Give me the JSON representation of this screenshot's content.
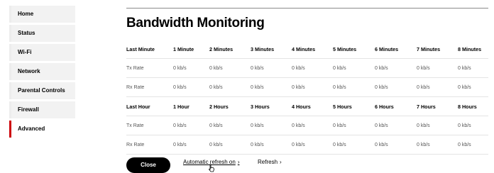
{
  "sidebar": {
    "items": [
      {
        "label": "Home"
      },
      {
        "label": "Status"
      },
      {
        "label": "Wi-Fi"
      },
      {
        "label": "Network"
      },
      {
        "label": "Parental Controls"
      },
      {
        "label": "Firewall"
      },
      {
        "label": "Advanced"
      }
    ],
    "active_index": 6,
    "active_color": "#cd040b"
  },
  "main": {
    "title": "Bandwidth Monitoring",
    "minute_table": {
      "header": [
        "Last Minute",
        "1 Minute",
        "2 Minutes",
        "3 Minutes",
        "4 Minutes",
        "5 Minutes",
        "6 Minutes",
        "7 Minutes",
        "8 Minutes"
      ],
      "rows": [
        [
          "Tx Rate",
          "0 kb/s",
          "0 kb/s",
          "0 kb/s",
          "0 kb/s",
          "0 kb/s",
          "0 kb/s",
          "0 kb/s",
          "0 kb/s"
        ],
        [
          "Rx Rate",
          "0 kb/s",
          "0 kb/s",
          "0 kb/s",
          "0 kb/s",
          "0 kb/s",
          "0 kb/s",
          "0 kb/s",
          "0 kb/s"
        ]
      ]
    },
    "hour_table": {
      "header": [
        "Last Hour",
        "1 Hour",
        "2 Hours",
        "3 Hours",
        "4 Hours",
        "5 Hours",
        "6 Hours",
        "7 Hours",
        "8 Hours"
      ],
      "rows": [
        [
          "Tx Rate",
          "0 kb/s",
          "0 kb/s",
          "0 kb/s",
          "0 kb/s",
          "0 kb/s",
          "0 kb/s",
          "0 kb/s",
          "0 kb/s"
        ],
        [
          "Rx Rate",
          "0 kb/s",
          "0 kb/s",
          "0 kb/s",
          "0 kb/s",
          "0 kb/s",
          "0 kb/s",
          "0 kb/s",
          "0 kb/s"
        ]
      ]
    }
  },
  "footer": {
    "close_label": "Close",
    "auto_refresh_label": "Automatic refresh on",
    "refresh_label": "Refresh",
    "chevron": "›",
    "cursor_icon": "hand-pointer-icon"
  }
}
